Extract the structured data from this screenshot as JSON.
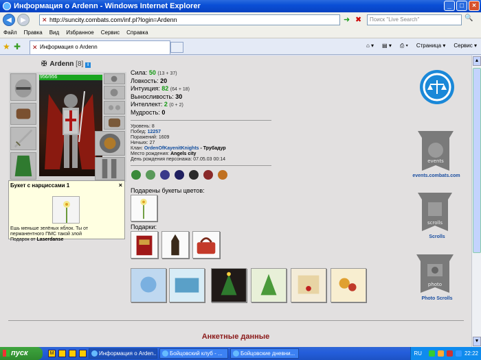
{
  "window": {
    "title": "Информация о Ardenn - Windows Internet Explorer",
    "minimize": "_",
    "maximize": "□",
    "close": "×"
  },
  "browser": {
    "back_label": "◀",
    "forward_label": "▶",
    "address": "http://suncity.combats.com/inf.pl?login=Ardenn",
    "search_placeholder": "Поиск \"Live Search\"",
    "menu": [
      "Файл",
      "Правка",
      "Вид",
      "Избранное",
      "Сервис",
      "Справка"
    ],
    "tab_title": "Информация о Ardenn",
    "tools": {
      "page": "Страница",
      "service": "Сервис"
    }
  },
  "character": {
    "name": "Ardenn",
    "level": "[8]",
    "info_icon": "i",
    "hp": "956/956",
    "stats": [
      {
        "label": "Сила:",
        "value": "50",
        "extra": "(13 + 37)",
        "green": true
      },
      {
        "label": "Ловкость:",
        "value": "20",
        "extra": "",
        "green": false
      },
      {
        "label": "Интуиция:",
        "value": "82",
        "extra": "(64 + 18)",
        "green": true
      },
      {
        "label": "Выносливость:",
        "value": "30",
        "extra": "",
        "green": false
      },
      {
        "label": "Интеллект:",
        "value": "2",
        "extra": "(0 + 2)",
        "green": true
      },
      {
        "label": "Мудрость:",
        "value": "0",
        "extra": "",
        "green": false
      }
    ],
    "level_label": "Уровень:",
    "level_value": "8",
    "wins_label": "Побед:",
    "wins_value": "12257",
    "losses_label": "Поражений:",
    "losses_value": "1609",
    "draws_label": "Ничьих:",
    "draws_value": "27",
    "clan_label": "Клан:",
    "clan_value": "OrdenOfKayenitKnights",
    "clan_suffix": " - Трубадур",
    "birthplace_label": "Место рождения:",
    "birthplace_value": "Angels city",
    "birthday_label": "День рождения персонажа:",
    "birthday_value": "07.05.03 00:14"
  },
  "tooltip": {
    "title": "Букет с нарциссами 1",
    "close": "×",
    "line1": "Ешь меньше зелёных яблок. Ты от",
    "line2": "перманентного ПМС такой злой",
    "line3_prefix": "Подарок от ",
    "line3_sender": "Laserdanse"
  },
  "sections": {
    "flowers_label": "Подарены букеты цветов:",
    "gifts_label": "Подарки:",
    "footer_title": "Анкетные данные"
  },
  "sidebar": {
    "events_label": "events.combats.com",
    "scrolls_label": "Scrolls",
    "photo_label": "Photo Scrolls"
  },
  "badge_colors": [
    "#3a8a3a",
    "#5a9a5a",
    "#3a3a8a",
    "#202060",
    "#2a2a2a",
    "#8a2a2a",
    "#c07020"
  ],
  "taskbar": {
    "start": "пуск",
    "tasks": [
      "Информация о Arden...",
      "Бойцовский клуб - ...",
      "Бойцовские дневни..."
    ],
    "lang": "RU",
    "time": "22:22"
  }
}
